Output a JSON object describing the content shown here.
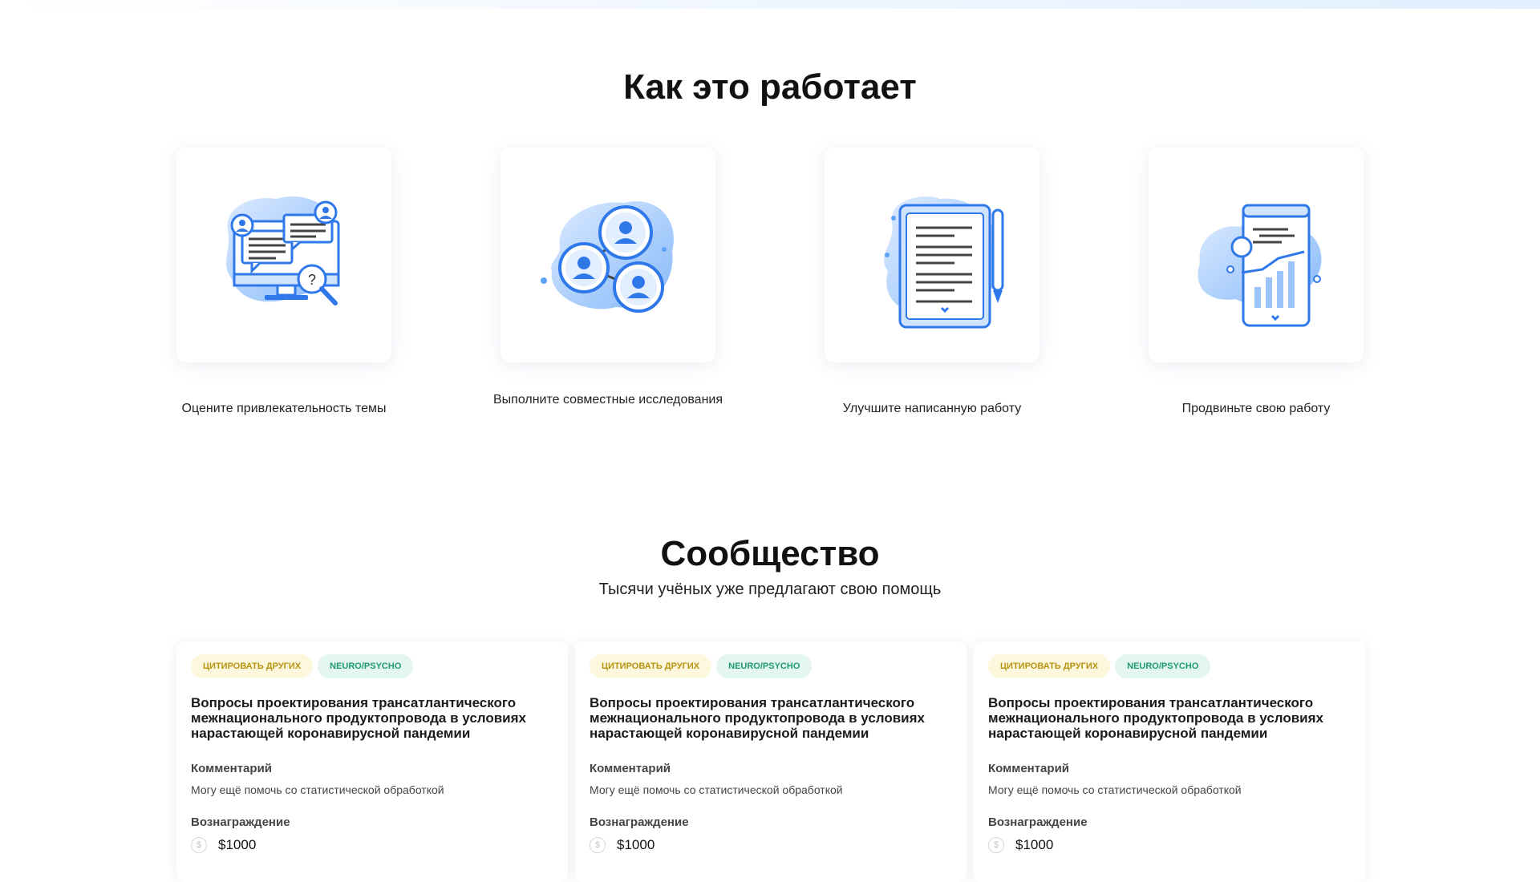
{
  "how_it_works": {
    "title": "Как это работает",
    "steps": [
      {
        "label": "Оцените привлекательность темы",
        "icon": "monitor-chat-magnifier-icon"
      },
      {
        "label": "Выполните совместные исследования",
        "icon": "connected-users-icon"
      },
      {
        "label": "Улучшите написанную работу",
        "icon": "document-pen-icon"
      },
      {
        "label": "Продвиньте свою работу",
        "icon": "phone-growth-chart-icon"
      }
    ]
  },
  "community": {
    "title": "Сообщество",
    "subtitle": "Тысячи учёных уже предлагают свою помощь",
    "cards": [
      {
        "tags": [
          "Цитировать других",
          "Neuro/Psycho"
        ],
        "title": "Вопросы проектирования трансатлантического межнационального продуктопровода в условиях нарастающей коронавирусной пандемии",
        "comment_label": "Комментарий",
        "comment": "Могу ещё помочь со статистической обработкой",
        "reward_label": "Вознаграждение",
        "reward": "$1000"
      },
      {
        "tags": [
          "Цитировать других",
          "Neuro/Psycho"
        ],
        "title": "Вопросы проектирования трансатлантического межнационального продуктопровода в условиях нарастающей коронавирусной пандемии",
        "comment_label": "Комментарий",
        "comment": "Могу ещё помочь со статистической обработкой",
        "reward_label": "Вознаграждение",
        "reward": "$1000"
      },
      {
        "tags": [
          "Цитировать других",
          "Neuro/Psycho"
        ],
        "title": "Вопросы проектирования трансатлантического межнационального продуктопровода в условиях нарастающей коронавирусной пандемии",
        "comment_label": "Комментарий",
        "comment": "Могу ещё помочь со статистической обработкой",
        "reward_label": "Вознаграждение",
        "reward": "$1000"
      }
    ]
  },
  "colors": {
    "accent_blue": "#3b82f6",
    "tag_yellow_text": "#b7940f",
    "tag_green_text": "#1e9a72",
    "coin_icon": "coin-icon"
  }
}
